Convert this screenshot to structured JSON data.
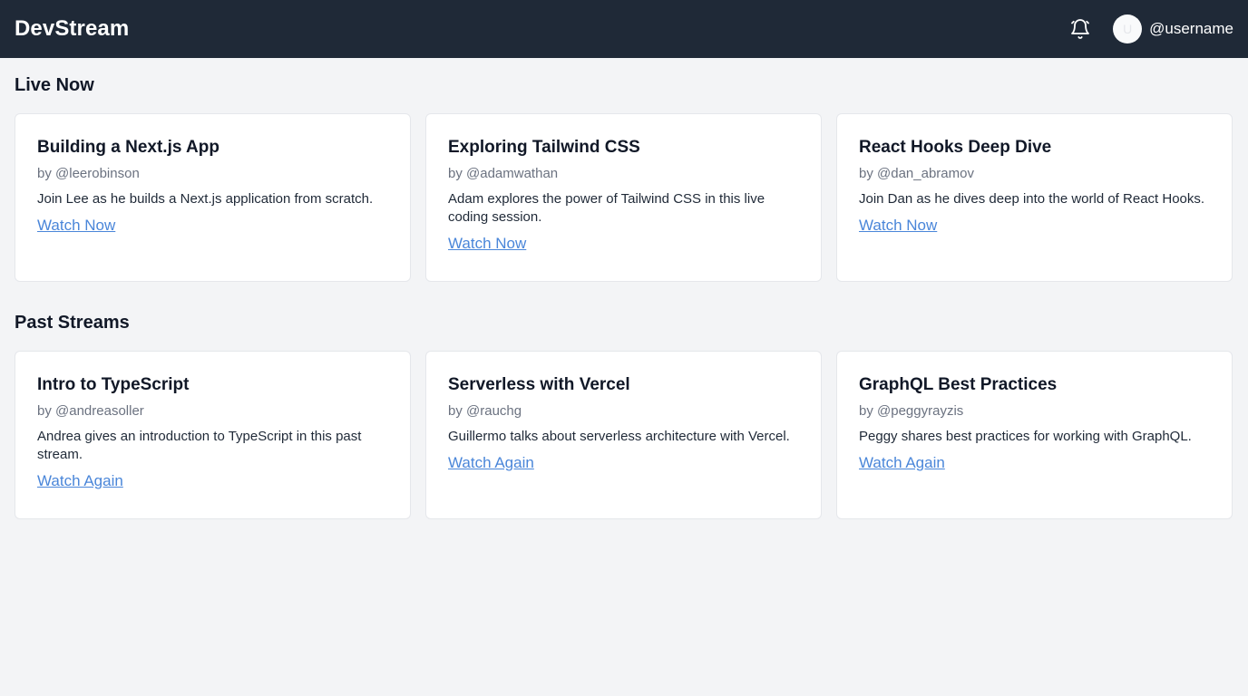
{
  "header": {
    "logo": "DevStream",
    "notification_icon": "bell-icon",
    "avatar_initial": "U",
    "username": "@username"
  },
  "live": {
    "title": "Live Now",
    "cards": [
      {
        "title": "Building a Next.js App",
        "author": "by @leerobinson",
        "description": "Join Lee as he builds a Next.js application from scratch.",
        "link": "Watch Now"
      },
      {
        "title": "Exploring Tailwind CSS",
        "author": "by @adamwathan",
        "description": "Adam explores the power of Tailwind CSS in this live coding session.",
        "link": "Watch Now"
      },
      {
        "title": "React Hooks Deep Dive",
        "author": "by @dan_abramov",
        "description": "Join Dan as he dives deep into the world of React Hooks.",
        "link": "Watch Now"
      }
    ]
  },
  "past": {
    "title": "Past Streams",
    "cards": [
      {
        "title": "Intro to TypeScript",
        "author": "by @andreasoller",
        "description": "Andrea gives an introduction to TypeScript in this past stream.",
        "link": "Watch Again"
      },
      {
        "title": "Serverless with Vercel",
        "author": "by @rauchg",
        "description": "Guillermo talks about serverless architecture with Vercel.",
        "link": "Watch Again"
      },
      {
        "title": "GraphQL Best Practices",
        "author": "by @peggyrayzis",
        "description": "Peggy shares best practices for working with GraphQL.",
        "link": "Watch Again"
      }
    ]
  },
  "colors": {
    "header_bg": "#1f2937",
    "page_bg": "#f3f4f6",
    "link": "#4a86d9",
    "muted_text": "#6b7280"
  }
}
